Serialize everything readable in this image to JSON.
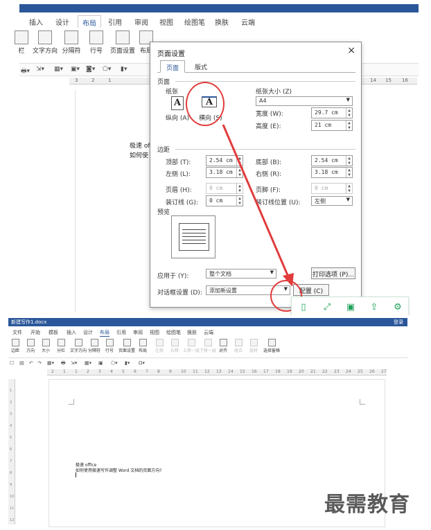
{
  "top": {
    "tabs": [
      "插入",
      "设计",
      "布局",
      "引用",
      "审阅",
      "视图",
      "绘图笔",
      "换肤",
      "云端"
    ],
    "active_tab": "布局",
    "ribbon": [
      "栏",
      "文字方向",
      "分隔符",
      "行号",
      "页面设置",
      "布局"
    ],
    "ruler_labels": [
      "3",
      "2",
      "1",
      "14",
      "15",
      "16"
    ],
    "doc_lines": [
      "极速 of",
      "如何使"
    ]
  },
  "dialog": {
    "title": "页面设置",
    "close": "×",
    "tabs": [
      "页面",
      "版式"
    ],
    "section_page": "页面",
    "paper_label": "纸张",
    "portrait_label": "纵向 (A)",
    "landscape_label": "横向 (S)",
    "paper_size_label": "纸张大小 (Z)",
    "paper_size_value": "A4",
    "width_label": "宽度 (W):",
    "width_value": "29.7 cm",
    "height_label": "高度 (E):",
    "height_value": "21 cm",
    "section_margins": "边距",
    "top_label": "顶部 (T):",
    "top_value": "2.54 cm",
    "bottom_label": "底部 (B):",
    "bottom_value": "2.54 cm",
    "left_label": "左侧 (L):",
    "left_value": "3.18 cm",
    "right_label": "右侧 (R):",
    "right_value": "3.18 cm",
    "header_label": "页眉 (H):",
    "header_value": "0 cm",
    "footer_label": "页脚 (F):",
    "footer_value": "0 cm",
    "gutter_label": "装订线 (G):",
    "gutter_value": "0 cm",
    "gutter_pos_label": "装订线位置 (U):",
    "gutter_pos_value": "左侧",
    "section_preview": "预览",
    "apply_label": "应用于 (Y):",
    "apply_value": "整个文档",
    "print_options": "打印选项 (P)...",
    "dialog_settings_label": "对话框设置 (D):",
    "dialog_settings_value": "添加新设置",
    "config_button": "配置 (C)"
  },
  "bottom": {
    "title": "新建写作1.docx",
    "title_right": "登录",
    "tabs": [
      "文件",
      "开始",
      "模板",
      "插入",
      "设计",
      "布局",
      "引用",
      "审阅",
      "视图",
      "绘图笔",
      "换肤",
      "云端"
    ],
    "active_tab": "布局",
    "ribbon": [
      "边距",
      "方向",
      "大小",
      "分栏",
      "文字方向",
      "分隔符",
      "行号",
      "页面设置",
      "布局"
    ],
    "ribbon_dim": [
      "左移",
      "右移",
      "上移一层",
      "下移一层",
      "对齐",
      "组合",
      "旋转"
    ],
    "ribbon_last": "选择窗格",
    "ruler_labels": [
      "2",
      "1",
      "1",
      "2",
      "3",
      "4",
      "5",
      "6",
      "7",
      "8",
      "9",
      "10",
      "11",
      "12",
      "13",
      "14",
      "15",
      "16",
      "17",
      "18",
      "19",
      "20",
      "21",
      "22",
      "23",
      "24",
      "25",
      "26",
      "27"
    ],
    "vruler_labels": [
      "1",
      "2",
      "3",
      "4",
      "5",
      "6",
      "7",
      "8",
      "9",
      "10",
      "11",
      "12"
    ],
    "doc_line1": "极速 office",
    "doc_line2": "如何使用极速写作调整 Word 文档的页面方向?"
  },
  "watermark": "最需教育",
  "colors": {
    "accent": "#2b579a",
    "annotation": "#e23b3b",
    "float_icons": "#22a15a"
  },
  "icons": [
    "portrait-orientation-icon",
    "landscape-orientation-icon",
    "phone-icon",
    "expand-icon",
    "save-icon",
    "share-icon",
    "settings-icon"
  ]
}
